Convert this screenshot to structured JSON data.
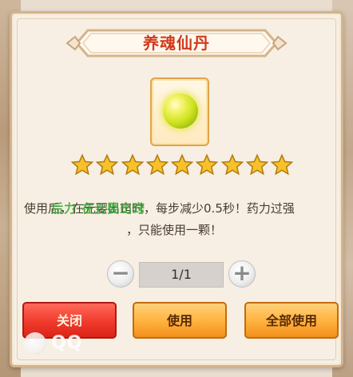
{
  "dialog": {
    "title": "养魂仙丹",
    "item": {
      "icon": "green-pill-orb-icon"
    },
    "rating": {
      "stars": 9,
      "max": 9
    },
    "description_line1": "使用后，在元婴出窍时，每步减少0.5秒！药力过强",
    "description_line2": "，只能使用一颗！",
    "overlay_text": "后力 在元婴出窍",
    "quantity": {
      "value": "1/1"
    },
    "buttons": {
      "close_label": "关闭",
      "use_label": "使用",
      "use_all_label": "全部使用"
    }
  },
  "watermark": {
    "text": "QQ"
  },
  "colors": {
    "title": "#d23a1b",
    "close_button": "#f03a2c",
    "use_button": "#ffb13c",
    "border": "#d4b48c",
    "star": "#f6c12a"
  }
}
